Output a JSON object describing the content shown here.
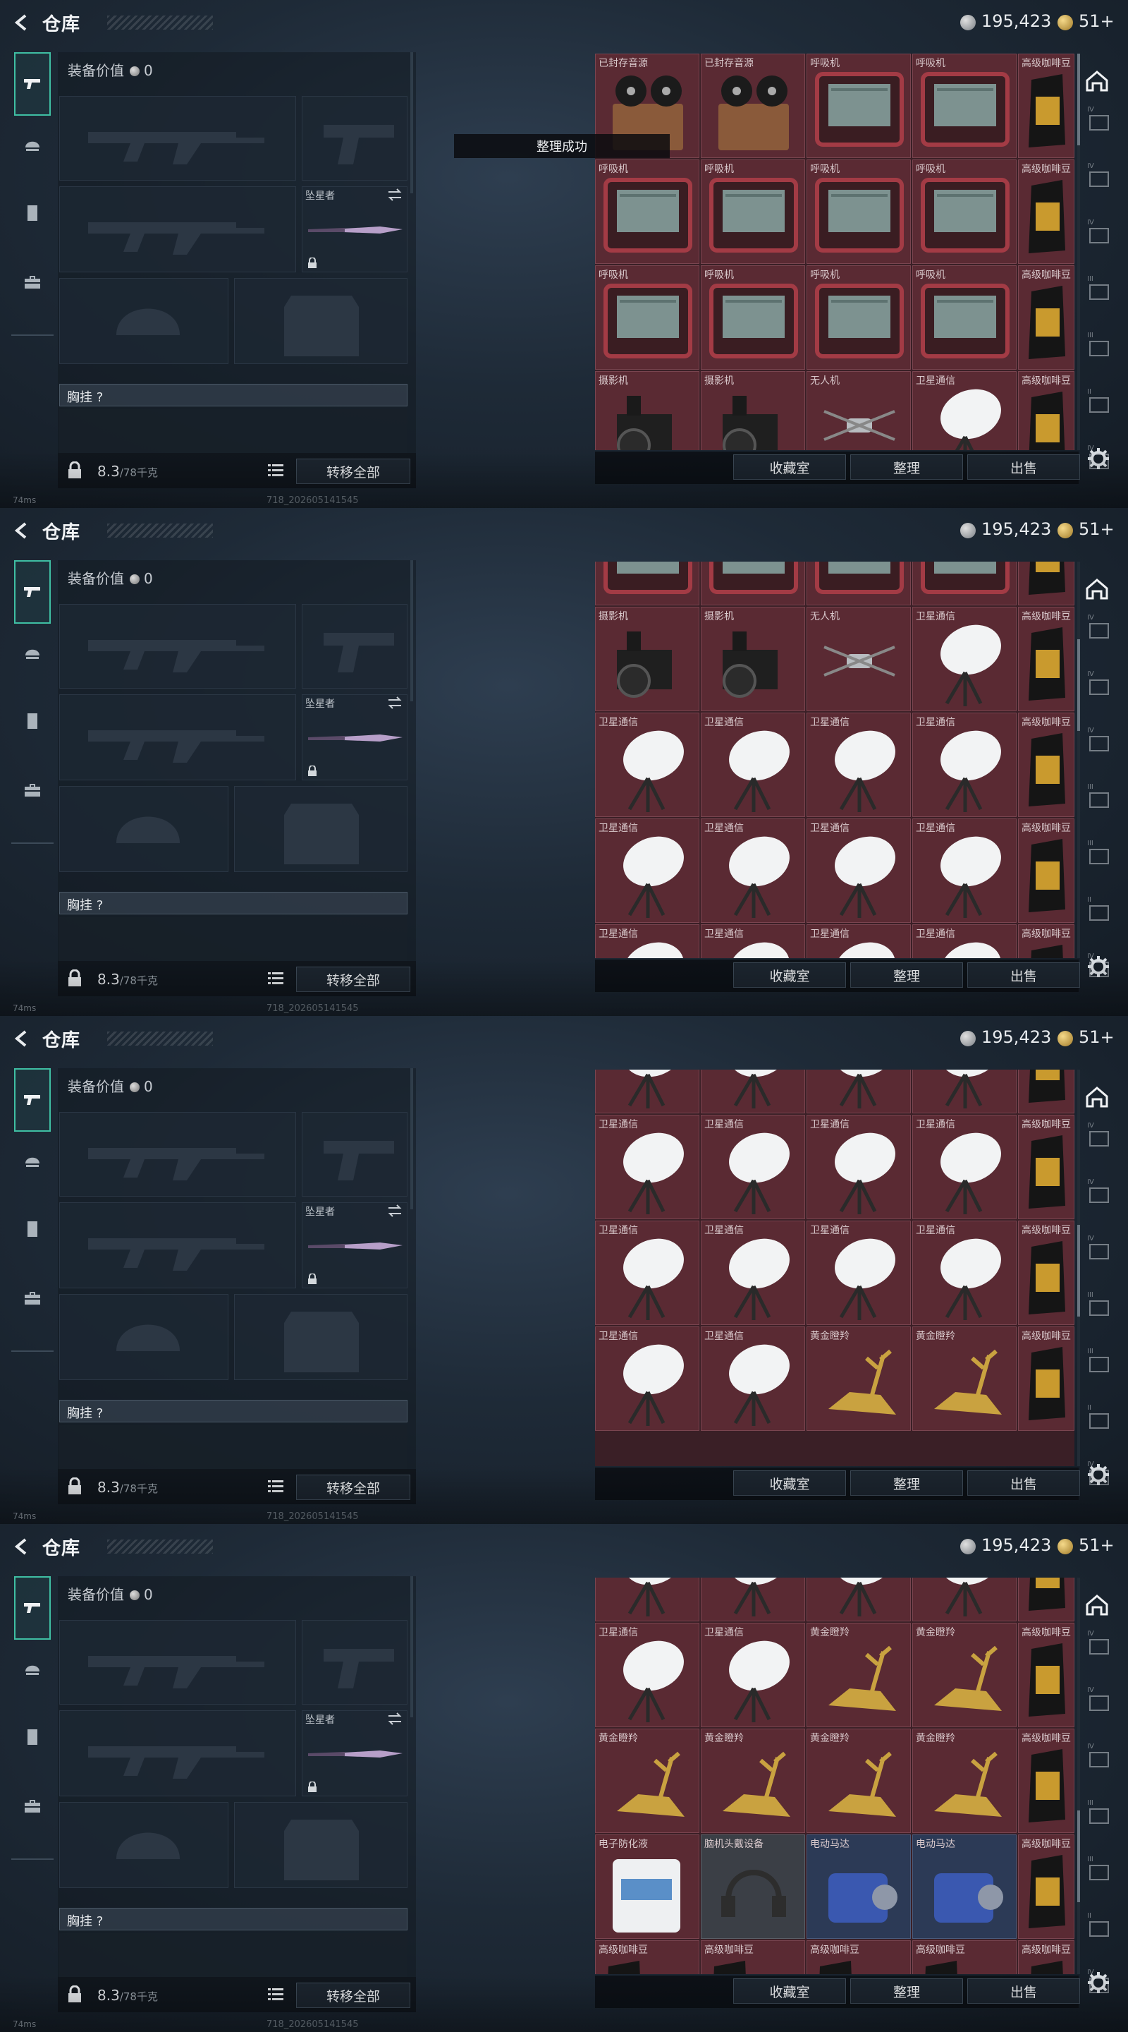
{
  "app": {
    "title": "仓库",
    "currency_silver": "195,423",
    "currency_gold": "51+",
    "toast": "整理成功"
  },
  "equipment": {
    "value_label": "装备价值",
    "value": "0",
    "melee_slot_label": "坠星者",
    "chest_label": "胸挂 ?",
    "weight": "8.3",
    "weight_cap": "/78千克",
    "transfer_all": "转移全部"
  },
  "stash": {
    "buttons": {
      "collection": "收藏室",
      "sort": "整理",
      "sell": "出售"
    },
    "screens": [
      {
        "offset": 0,
        "rows": [
          [
            "已封存音源",
            "已封存音源",
            "呼吸机",
            "呼吸机",
            "高级咖啡豆"
          ],
          [
            "呼吸机",
            "呼吸机",
            "呼吸机",
            "呼吸机",
            "高级咖啡豆"
          ],
          [
            "呼吸机",
            "呼吸机",
            "呼吸机",
            "呼吸机",
            "高级咖啡豆"
          ],
          [
            "摄影机",
            "摄影机",
            "无人机",
            "卫星通信",
            "高级咖啡豆"
          ]
        ]
      },
      {
        "offset": 1,
        "rows": [
          [
            "呼吸机",
            "呼吸机",
            "呼吸机",
            "呼吸机",
            "高级咖啡豆"
          ],
          [
            "摄影机",
            "摄影机",
            "无人机",
            "卫星通信",
            "高级咖啡豆"
          ],
          [
            "卫星通信",
            "卫星通信",
            "卫星通信",
            "卫星通信",
            "高级咖啡豆"
          ],
          [
            "卫星通信",
            "卫星通信",
            "卫星通信",
            "卫星通信",
            "高级咖啡豆"
          ],
          [
            "卫星通信",
            "卫星通信",
            "卫星通信",
            "卫星通信",
            "高级咖啡豆"
          ]
        ]
      },
      {
        "offset": 2,
        "rows": [
          [
            "卫星通信",
            "卫星通信",
            "卫星通信",
            "卫星通信",
            "高级咖啡豆"
          ],
          [
            "卫星通信",
            "卫星通信",
            "卫星通信",
            "卫星通信",
            "高级咖啡豆"
          ],
          [
            "卫星通信",
            "卫星通信",
            "卫星通信",
            "卫星通信",
            "高级咖啡豆"
          ],
          [
            "卫星通信",
            "卫星通信",
            "黄金瞪羚",
            "黄金瞪羚",
            "高级咖啡豆"
          ]
        ]
      },
      {
        "offset": 3,
        "rows": [
          [
            "卫星通信",
            "卫星通信",
            "卫星通信",
            "卫星通信",
            "高级咖啡豆"
          ],
          [
            "卫星通信",
            "卫星通信",
            "黄金瞪羚",
            "黄金瞪羚",
            "高级咖啡豆"
          ],
          [
            "黄金瞪羚",
            "黄金瞪羚",
            "黄金瞪羚",
            "黄金瞪羚",
            "高级咖啡豆"
          ],
          [
            "电子防化液",
            "脑机头戴设备",
            "电动马达",
            "电动马达",
            "高级咖啡豆"
          ],
          [
            "高级咖啡豆",
            "高级咖啡豆",
            "高级咖啡豆",
            "高级咖啡豆",
            "高级咖啡豆"
          ]
        ]
      }
    ]
  },
  "right_tabs": [
    "IV",
    "IV",
    "IV",
    "III",
    "III",
    "II",
    "IV"
  ],
  "status": {
    "ping": "74ms",
    "build": "718_202605141545"
  }
}
